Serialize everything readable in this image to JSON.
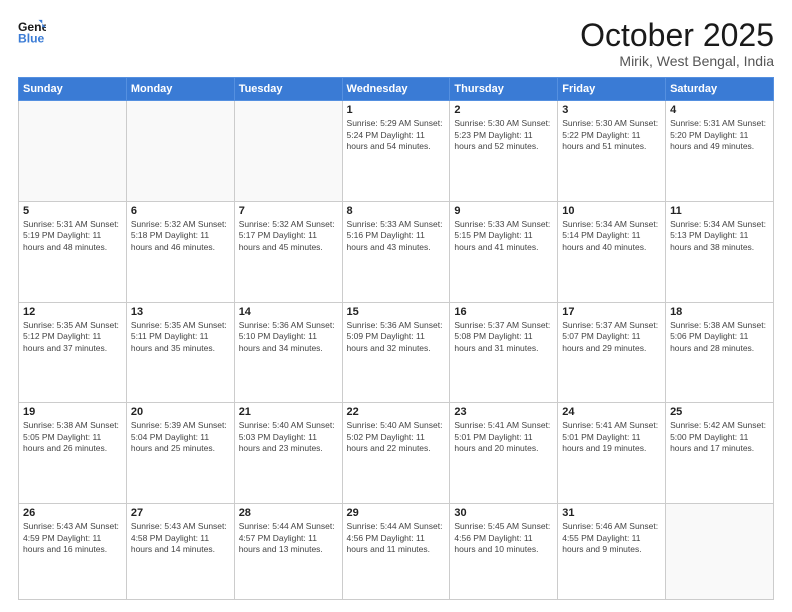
{
  "header": {
    "logo_line1": "General",
    "logo_line2": "Blue",
    "month": "October 2025",
    "location": "Mirik, West Bengal, India"
  },
  "weekdays": [
    "Sunday",
    "Monday",
    "Tuesday",
    "Wednesday",
    "Thursday",
    "Friday",
    "Saturday"
  ],
  "weeks": [
    [
      {
        "day": "",
        "info": ""
      },
      {
        "day": "",
        "info": ""
      },
      {
        "day": "",
        "info": ""
      },
      {
        "day": "1",
        "info": "Sunrise: 5:29 AM\nSunset: 5:24 PM\nDaylight: 11 hours\nand 54 minutes."
      },
      {
        "day": "2",
        "info": "Sunrise: 5:30 AM\nSunset: 5:23 PM\nDaylight: 11 hours\nand 52 minutes."
      },
      {
        "day": "3",
        "info": "Sunrise: 5:30 AM\nSunset: 5:22 PM\nDaylight: 11 hours\nand 51 minutes."
      },
      {
        "day": "4",
        "info": "Sunrise: 5:31 AM\nSunset: 5:20 PM\nDaylight: 11 hours\nand 49 minutes."
      }
    ],
    [
      {
        "day": "5",
        "info": "Sunrise: 5:31 AM\nSunset: 5:19 PM\nDaylight: 11 hours\nand 48 minutes."
      },
      {
        "day": "6",
        "info": "Sunrise: 5:32 AM\nSunset: 5:18 PM\nDaylight: 11 hours\nand 46 minutes."
      },
      {
        "day": "7",
        "info": "Sunrise: 5:32 AM\nSunset: 5:17 PM\nDaylight: 11 hours\nand 45 minutes."
      },
      {
        "day": "8",
        "info": "Sunrise: 5:33 AM\nSunset: 5:16 PM\nDaylight: 11 hours\nand 43 minutes."
      },
      {
        "day": "9",
        "info": "Sunrise: 5:33 AM\nSunset: 5:15 PM\nDaylight: 11 hours\nand 41 minutes."
      },
      {
        "day": "10",
        "info": "Sunrise: 5:34 AM\nSunset: 5:14 PM\nDaylight: 11 hours\nand 40 minutes."
      },
      {
        "day": "11",
        "info": "Sunrise: 5:34 AM\nSunset: 5:13 PM\nDaylight: 11 hours\nand 38 minutes."
      }
    ],
    [
      {
        "day": "12",
        "info": "Sunrise: 5:35 AM\nSunset: 5:12 PM\nDaylight: 11 hours\nand 37 minutes."
      },
      {
        "day": "13",
        "info": "Sunrise: 5:35 AM\nSunset: 5:11 PM\nDaylight: 11 hours\nand 35 minutes."
      },
      {
        "day": "14",
        "info": "Sunrise: 5:36 AM\nSunset: 5:10 PM\nDaylight: 11 hours\nand 34 minutes."
      },
      {
        "day": "15",
        "info": "Sunrise: 5:36 AM\nSunset: 5:09 PM\nDaylight: 11 hours\nand 32 minutes."
      },
      {
        "day": "16",
        "info": "Sunrise: 5:37 AM\nSunset: 5:08 PM\nDaylight: 11 hours\nand 31 minutes."
      },
      {
        "day": "17",
        "info": "Sunrise: 5:37 AM\nSunset: 5:07 PM\nDaylight: 11 hours\nand 29 minutes."
      },
      {
        "day": "18",
        "info": "Sunrise: 5:38 AM\nSunset: 5:06 PM\nDaylight: 11 hours\nand 28 minutes."
      }
    ],
    [
      {
        "day": "19",
        "info": "Sunrise: 5:38 AM\nSunset: 5:05 PM\nDaylight: 11 hours\nand 26 minutes."
      },
      {
        "day": "20",
        "info": "Sunrise: 5:39 AM\nSunset: 5:04 PM\nDaylight: 11 hours\nand 25 minutes."
      },
      {
        "day": "21",
        "info": "Sunrise: 5:40 AM\nSunset: 5:03 PM\nDaylight: 11 hours\nand 23 minutes."
      },
      {
        "day": "22",
        "info": "Sunrise: 5:40 AM\nSunset: 5:02 PM\nDaylight: 11 hours\nand 22 minutes."
      },
      {
        "day": "23",
        "info": "Sunrise: 5:41 AM\nSunset: 5:01 PM\nDaylight: 11 hours\nand 20 minutes."
      },
      {
        "day": "24",
        "info": "Sunrise: 5:41 AM\nSunset: 5:01 PM\nDaylight: 11 hours\nand 19 minutes."
      },
      {
        "day": "25",
        "info": "Sunrise: 5:42 AM\nSunset: 5:00 PM\nDaylight: 11 hours\nand 17 minutes."
      }
    ],
    [
      {
        "day": "26",
        "info": "Sunrise: 5:43 AM\nSunset: 4:59 PM\nDaylight: 11 hours\nand 16 minutes."
      },
      {
        "day": "27",
        "info": "Sunrise: 5:43 AM\nSunset: 4:58 PM\nDaylight: 11 hours\nand 14 minutes."
      },
      {
        "day": "28",
        "info": "Sunrise: 5:44 AM\nSunset: 4:57 PM\nDaylight: 11 hours\nand 13 minutes."
      },
      {
        "day": "29",
        "info": "Sunrise: 5:44 AM\nSunset: 4:56 PM\nDaylight: 11 hours\nand 11 minutes."
      },
      {
        "day": "30",
        "info": "Sunrise: 5:45 AM\nSunset: 4:56 PM\nDaylight: 11 hours\nand 10 minutes."
      },
      {
        "day": "31",
        "info": "Sunrise: 5:46 AM\nSunset: 4:55 PM\nDaylight: 11 hours\nand 9 minutes."
      },
      {
        "day": "",
        "info": ""
      }
    ]
  ]
}
